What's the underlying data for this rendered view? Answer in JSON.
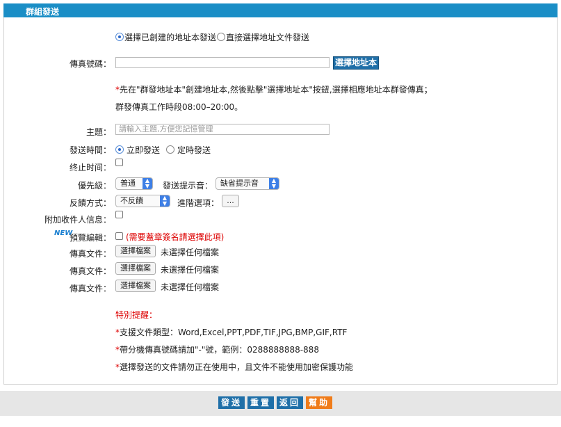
{
  "header": {
    "title": "群組發送"
  },
  "send_mode": {
    "option_address_book": "選擇已創建的地址本發送",
    "option_direct_file": "直接選擇地址文件發送"
  },
  "fax_number": {
    "label": "傳真號碼：",
    "value": "",
    "button": "選擇地址本"
  },
  "note": {
    "line1_mark": "*",
    "line1": "先在\"群發地址本\"創建地址本,然後點擊\"選擇地址本\"按鈕,選擇相應地址本群發傳真；",
    "line2": "群發傳真工作時段08:00–20:00。"
  },
  "subject": {
    "label": "主題：",
    "placeholder": "請輸入主題,方便您記憶管理"
  },
  "send_time": {
    "label": "發送時間：",
    "immediate": "立即發送",
    "scheduled": "定時發送"
  },
  "end_time": {
    "label": "终止时间："
  },
  "priority": {
    "label": "優先級：",
    "selected": "普通"
  },
  "notify_sound": {
    "label": "發送提示音：",
    "selected": "缺省提示音"
  },
  "feedback": {
    "label": "反饋方式：",
    "selected": "不反饋"
  },
  "advanced": {
    "label": "進階選項：",
    "button": "..."
  },
  "extra_recipient": {
    "label": "附加收件人信息："
  },
  "preview": {
    "badge": "NEW",
    "label": "預覽編輯：",
    "hint": "(需要蓋章簽名請選擇此項)"
  },
  "fax_files": [
    {
      "label": "傳真文件：",
      "button": "選擇檔案",
      "status": "未選擇任何檔案"
    },
    {
      "label": "傳真文件：",
      "button": "選擇檔案",
      "status": "未選擇任何檔案"
    },
    {
      "label": "傳真文件：",
      "button": "選擇檔案",
      "status": "未選擇任何檔案"
    }
  ],
  "reminder": {
    "title": "特別提醒：",
    "item1": "支援文件類型：Word,Excel,PPT,PDF,TIF,JPG,BMP,GIF,RTF",
    "item2": "帶分機傳真號碼請加\"-\"號，範例：0288888888-888",
    "item3": "選擇發送的文件請勿正在使用中，且文件不能使用加密保護功能"
  },
  "footer": {
    "send": "發送",
    "reset": "重置",
    "back": "返回",
    "help": "幫助"
  },
  "colors": {
    "header": "#1a8ec6",
    "button_blue": "#1f6fa8",
    "help_orange": "#f07c1a",
    "warn_red": "#d00000"
  }
}
